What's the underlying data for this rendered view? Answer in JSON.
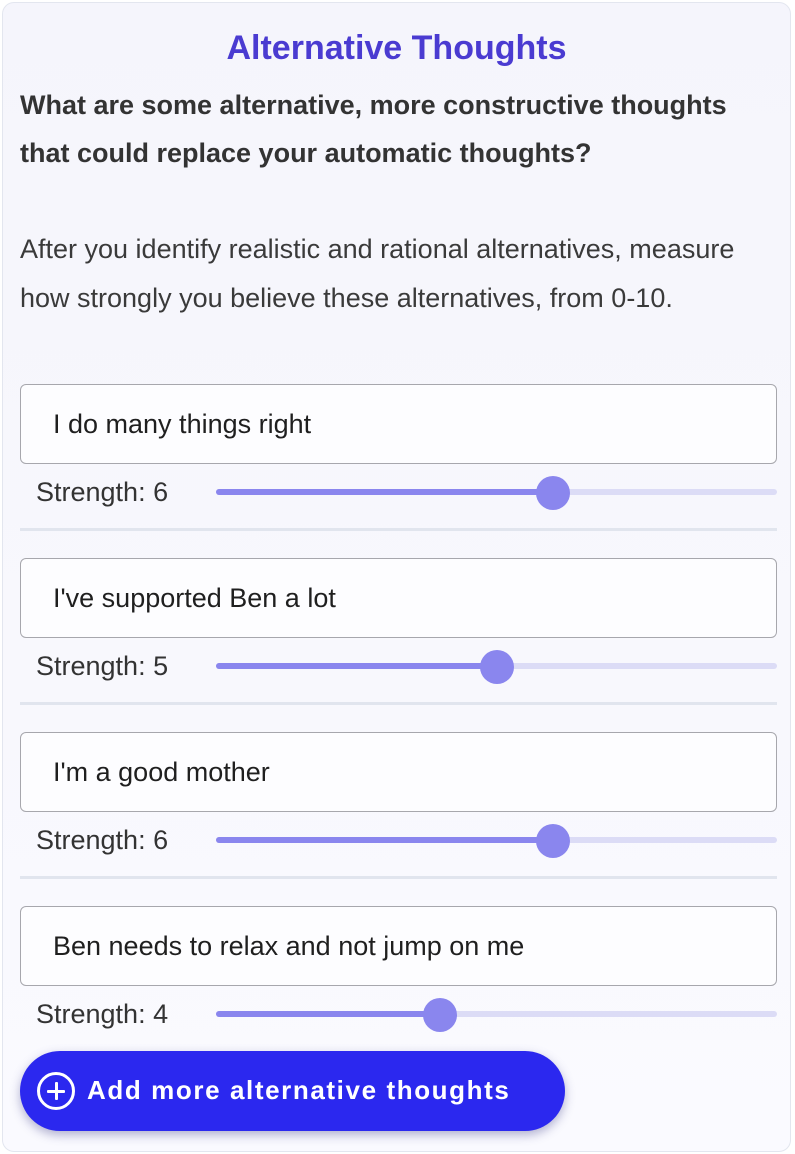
{
  "section": {
    "title": "Alternative Thoughts",
    "question": "What are some alternative, more constructive thoughts that could replace your automatic thoughts?",
    "instructions": "After you identify realistic and rational alternatives, measure how strongly you believe these alternatives, from 0-10."
  },
  "thoughts": [
    {
      "text": "I do many things right",
      "strength_label": "Strength: 6",
      "strength": 6
    },
    {
      "text": "I've supported Ben a lot",
      "strength_label": "Strength: 5",
      "strength": 5
    },
    {
      "text": "I'm a good mother",
      "strength_label": "Strength: 6",
      "strength": 6
    },
    {
      "text": "Ben needs to relax and not jump on me",
      "strength_label": "Strength: 4",
      "strength": 4
    }
  ],
  "slider_range": [
    0,
    10
  ],
  "add_button": {
    "label": "Add more alternative thoughts",
    "icon": "plus-circle-icon"
  },
  "colors": {
    "title": "#4a3bd1",
    "button_bg": "#2b28ef",
    "slider_fill": "#8a86ee",
    "slider_track": "#dcdcf6"
  }
}
